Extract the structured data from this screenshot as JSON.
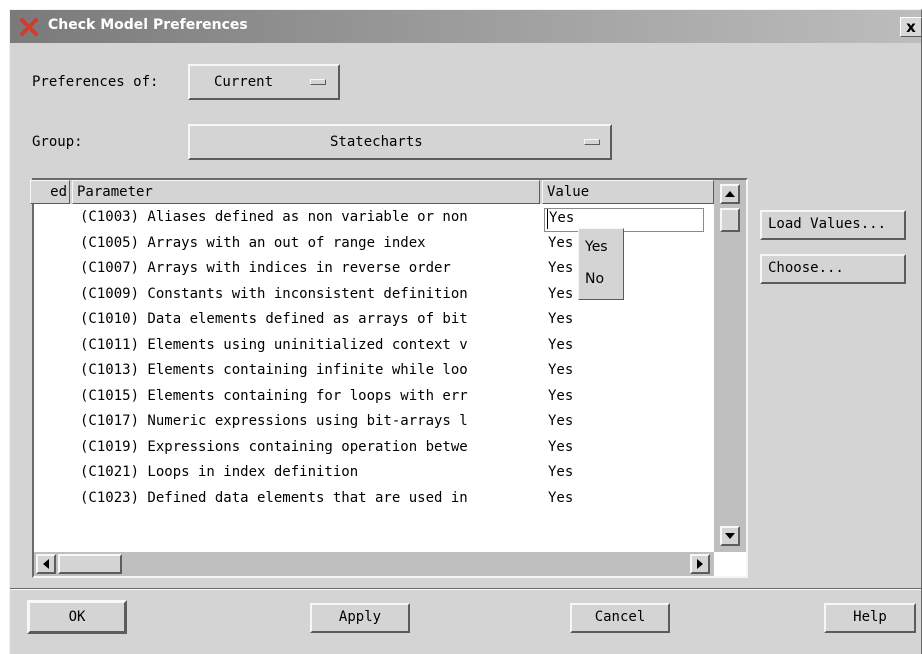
{
  "window": {
    "title": "Check Model Preferences",
    "close_label": "x"
  },
  "preferences_of": {
    "label": "Preferences of:",
    "value": "Current"
  },
  "group": {
    "label": "Group:",
    "value": "Statecharts"
  },
  "table": {
    "columns": [
      "ed",
      "Parameter",
      "Value"
    ],
    "rows": [
      {
        "param": "(C1003) Aliases defined as non variable or non",
        "value": "Yes"
      },
      {
        "param": "(C1005) Arrays with an out of range index",
        "value": "Yes"
      },
      {
        "param": "(C1007) Arrays with indices in reverse order",
        "value": "Yes"
      },
      {
        "param": "(C1009) Constants with inconsistent definition",
        "value": "Yes"
      },
      {
        "param": "(C1010) Data elements defined as arrays of bit",
        "value": "Yes"
      },
      {
        "param": "(C1011) Elements using uninitialized context v",
        "value": "Yes"
      },
      {
        "param": "(C1013) Elements containing infinite while loo",
        "value": "Yes"
      },
      {
        "param": "(C1015) Elements containing for loops with err",
        "value": "Yes"
      },
      {
        "param": "(C1017) Numeric expressions using bit-arrays l",
        "value": "Yes"
      },
      {
        "param": "(C1019) Expressions containing operation betwe",
        "value": "Yes"
      },
      {
        "param": "(C1021) Loops in index definition",
        "value": "Yes"
      },
      {
        "param": "(C1023) Defined data elements that are used in",
        "value": "Yes"
      }
    ],
    "edit_value": "Yes",
    "popup_options": [
      "Yes",
      "No"
    ]
  },
  "side_buttons": {
    "load_values": "Load Values...",
    "choose": "Choose..."
  },
  "footer": {
    "ok": "OK",
    "apply": "Apply",
    "cancel": "Cancel",
    "help": "Help"
  },
  "colors": {
    "dialog_bg": "#d4d4d4",
    "title_gradient_start": "#7a7a7a",
    "app_icon": "#d23b2e"
  }
}
